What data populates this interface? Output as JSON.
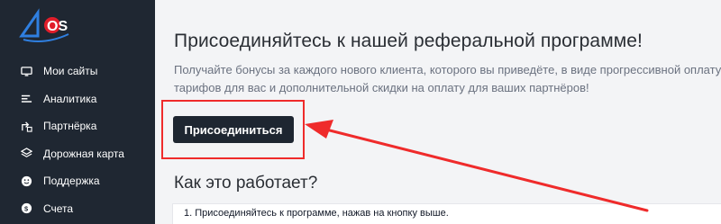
{
  "sidebar": {
    "items": [
      {
        "label": "Мои сайты",
        "icon": "monitor-icon"
      },
      {
        "label": "Аналитика",
        "icon": "bars-icon"
      },
      {
        "label": "Партнёрка",
        "icon": "share-icon"
      },
      {
        "label": "Дорожная карта",
        "icon": "layers-icon"
      },
      {
        "label": "Поддержка",
        "icon": "smile-icon"
      },
      {
        "label": "Счета",
        "icon": "coin-icon"
      }
    ]
  },
  "main": {
    "title": "Присоединяйтесь к нашей реферальной программе!",
    "description": "Получайте бонусы за каждого нового клиента, которого вы приведёте, в виде прогрессивной оплату тарифов для вас и дополнительной скидки на оплату для ваших партнёров!",
    "join_button": "Присоединиться",
    "how_title": "Как это работает?",
    "steps": [
      "1. Присоединяйтесь к программе, нажав на кнопку выше."
    ]
  },
  "colors": {
    "sidebar_bg": "#1f2732",
    "accent_red": "#ef2b2b",
    "logo_blue": "#1f6fd1"
  }
}
